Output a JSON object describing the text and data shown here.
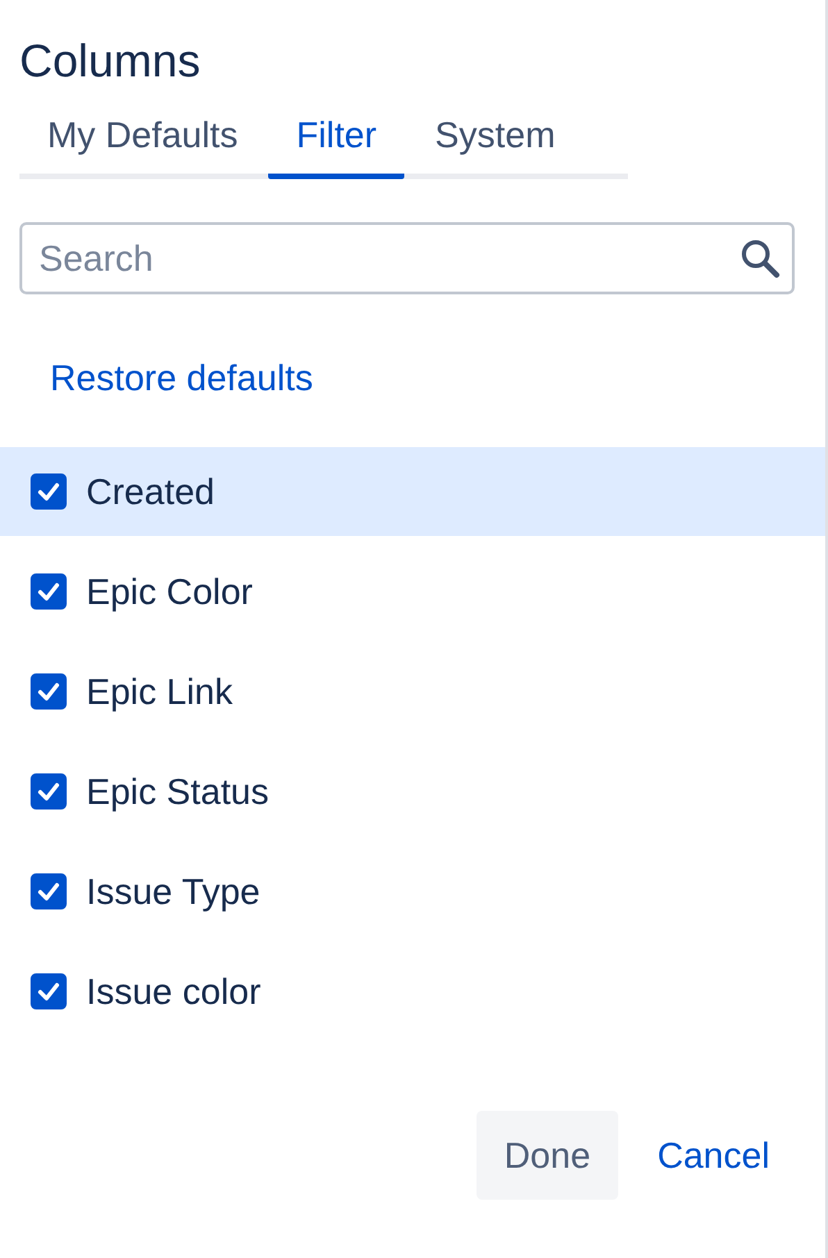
{
  "title": "Columns",
  "tabs": [
    {
      "label": "My Defaults",
      "selected": false
    },
    {
      "label": "Filter",
      "selected": true
    },
    {
      "label": "System",
      "selected": false
    }
  ],
  "search": {
    "placeholder": "Search"
  },
  "restore_link": "Restore defaults",
  "columns": [
    {
      "label": "Created",
      "checked": true,
      "selected": true
    },
    {
      "label": "Epic Color",
      "checked": true,
      "selected": false
    },
    {
      "label": "Epic Link",
      "checked": true,
      "selected": false
    },
    {
      "label": "Epic Status",
      "checked": true,
      "selected": false
    },
    {
      "label": "Issue Type",
      "checked": true,
      "selected": false
    },
    {
      "label": "Issue color",
      "checked": true,
      "selected": false
    }
  ],
  "buttons": {
    "primary": "Done",
    "secondary": "Cancel"
  }
}
